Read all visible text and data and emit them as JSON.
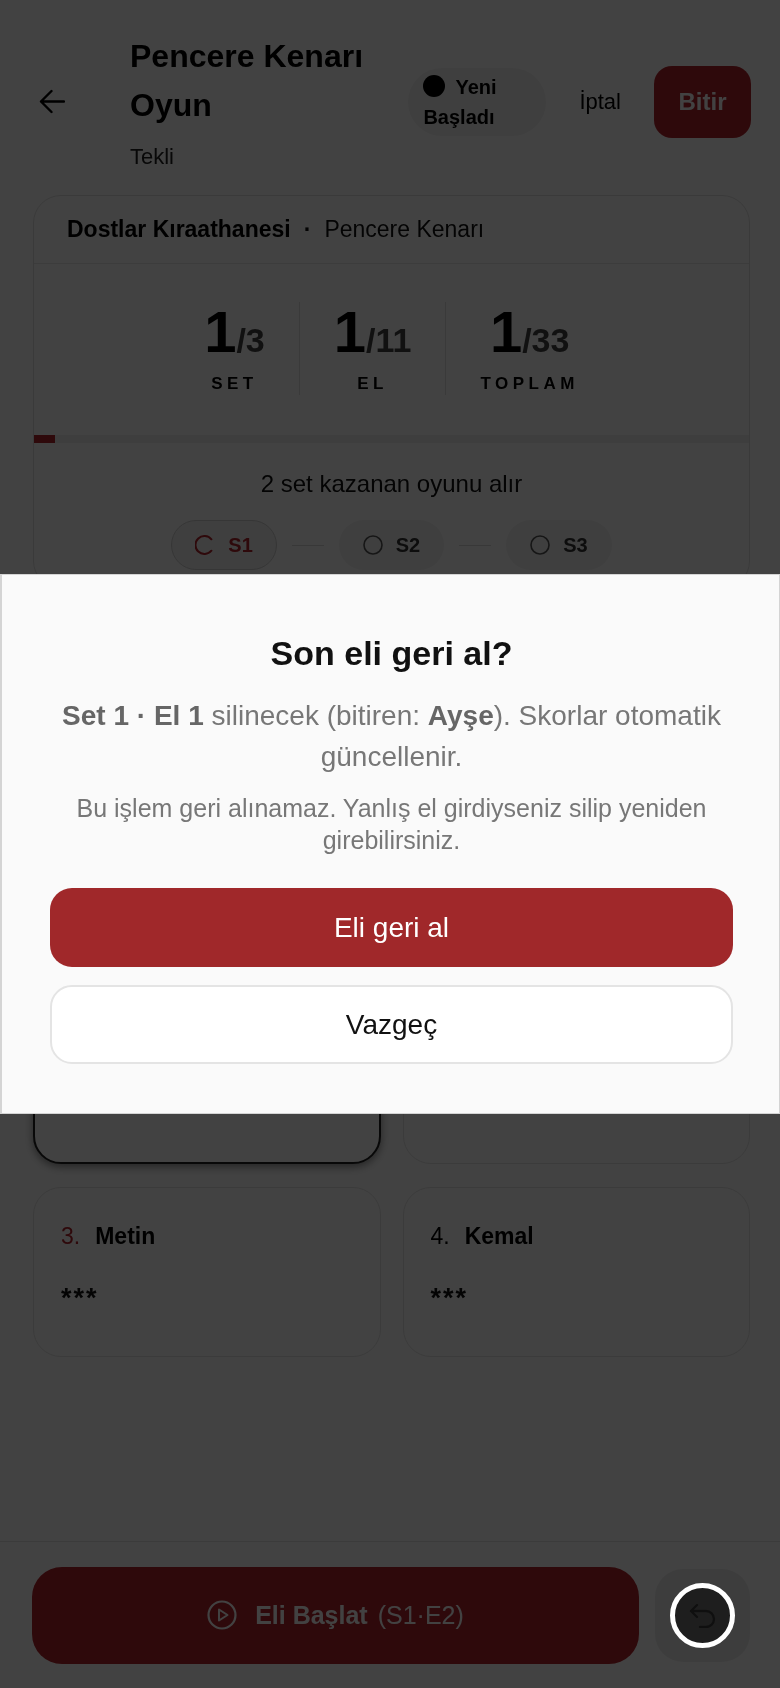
{
  "header": {
    "title": "Pencere Kenarı Oyun",
    "subtitle": "Tekli",
    "status": "Yeni Başladı",
    "cancel": "İptal",
    "finish": "Bitir"
  },
  "game_card": {
    "venue": "Dostlar Kıraathanesi",
    "separator": "·",
    "table": "Pencere Kenarı",
    "stats": [
      {
        "value": "1",
        "total": "/3",
        "label": "SET"
      },
      {
        "value": "1",
        "total": "/11",
        "label": "EL"
      },
      {
        "value": "1",
        "total": "/33",
        "label": "TOPLAM"
      }
    ],
    "progress": {
      "level": 0.03
    },
    "rule": "2 set kazanan oyunu alır",
    "sets": [
      {
        "label": "S1",
        "kind": "in_progress",
        "selected": true
      },
      {
        "label": "S2",
        "kind": "pending",
        "selected": false
      },
      {
        "label": "S3",
        "kind": "pending",
        "selected": false
      }
    ]
  },
  "players": [
    {
      "active": true
    },
    {
      "active": false
    },
    {
      "number": "3.",
      "name": "Metin",
      "score": "***",
      "highlighted": true,
      "active": false
    },
    {
      "number": "4.",
      "name": "Kemal",
      "score": "***",
      "highlighted": false,
      "active": false
    }
  ],
  "start_button": {
    "label": "Eli Başlat",
    "detail": "(S1·E2)"
  },
  "dialog": {
    "title": "Son eli geri al?",
    "message": "**Set 1 · El 1** silinecek (bitiren: **Ayşe**). Skorlar otomatik güncellenir.",
    "note": "Bu işlem geri alınamaz. Yanlış el girdiyseniz silip yeniden girebilirsiniz.",
    "confirm": "Eli geri al",
    "cancel": "Vazgeç"
  }
}
